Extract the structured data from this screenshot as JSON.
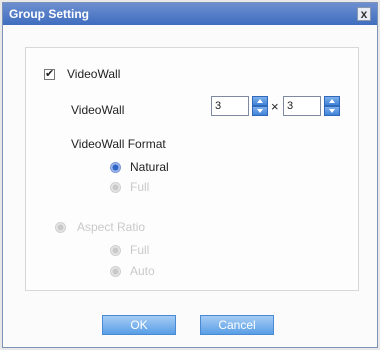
{
  "window": {
    "title": "Group Setting",
    "close_label": "x"
  },
  "videowall_checkbox": {
    "label": "VideoWall",
    "checked": true
  },
  "grid": {
    "label": "VideoWall",
    "rows": "3",
    "cols": "3",
    "separator": "×"
  },
  "format": {
    "label": "VideoWall Format",
    "options": [
      {
        "label": "Natural",
        "selected": true,
        "enabled": true
      },
      {
        "label": "Full",
        "selected": false,
        "enabled": false
      }
    ]
  },
  "aspect": {
    "label": "Aspect Ratio",
    "options": [
      {
        "label": "Full",
        "enabled": false
      },
      {
        "label": "Auto",
        "enabled": false
      }
    ]
  },
  "buttons": {
    "ok": "OK",
    "cancel": "Cancel"
  },
  "colors": {
    "title_bar": "#4f7cc9",
    "button": "#6aa8ec",
    "spinner": "#3f82d8"
  }
}
